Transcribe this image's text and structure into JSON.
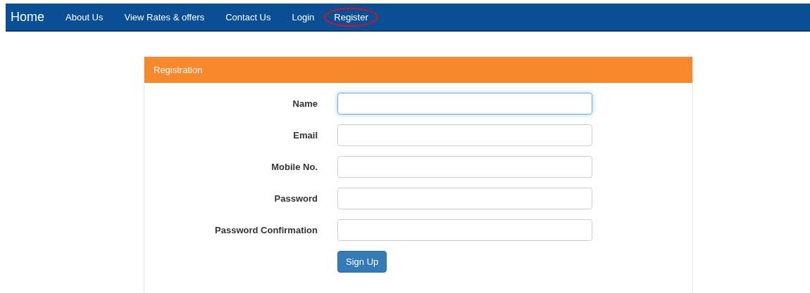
{
  "navbar": {
    "brand": "Home",
    "items": [
      {
        "label": "About Us",
        "circled": false
      },
      {
        "label": "View Rates & offers",
        "circled": false
      },
      {
        "label": "Contact Us",
        "circled": false
      },
      {
        "label": "Login",
        "circled": false
      },
      {
        "label": "Register",
        "circled": true
      }
    ]
  },
  "panel": {
    "title": "Registration",
    "fields": [
      {
        "label": "Name",
        "focused": true
      },
      {
        "label": "Email",
        "focused": false
      },
      {
        "label": "Mobile No.",
        "focused": false
      },
      {
        "label": "Password",
        "focused": false
      },
      {
        "label": "Password Confirmation",
        "focused": false
      }
    ],
    "submit": "Sign Up"
  }
}
